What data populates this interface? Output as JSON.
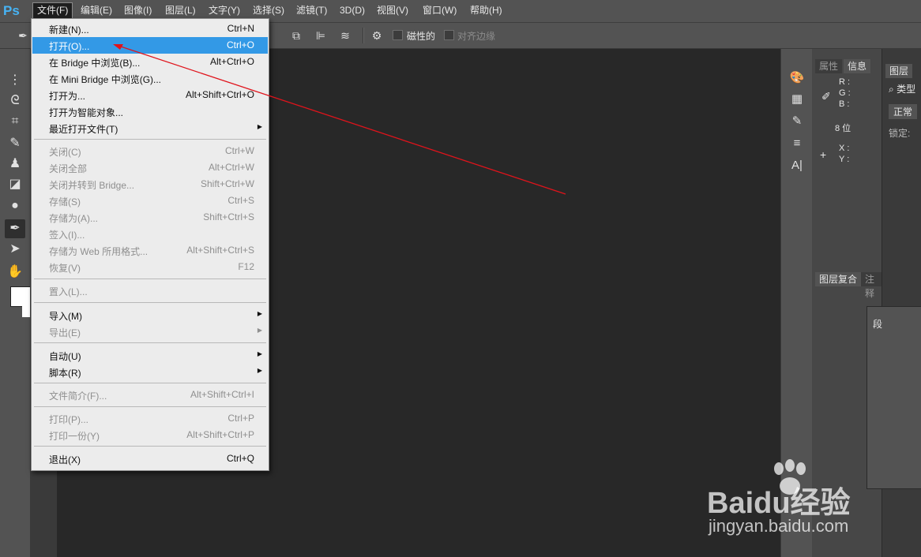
{
  "app": {
    "logo": "Ps"
  },
  "menubar": {
    "items": [
      "文件(F)",
      "编辑(E)",
      "图像(I)",
      "图层(L)",
      "文字(Y)",
      "选择(S)",
      "滤镜(T)",
      "3D(D)",
      "视图(V)",
      "窗口(W)",
      "帮助(H)"
    ]
  },
  "options_bar": {
    "magnetic_label": "磁性的",
    "align_edges_label": "对齐边缘"
  },
  "file_menu": {
    "items": [
      {
        "label": "新建(N)...",
        "shortcut": "Ctrl+N"
      },
      {
        "label": "打开(O)...",
        "shortcut": "Ctrl+O"
      },
      {
        "label": "在 Bridge 中浏览(B)...",
        "shortcut": "Alt+Ctrl+O"
      },
      {
        "label": "在 Mini Bridge 中浏览(G)...",
        "shortcut": ""
      },
      {
        "label": "打开为...",
        "shortcut": "Alt+Shift+Ctrl+O"
      },
      {
        "label": "打开为智能对象...",
        "shortcut": ""
      },
      {
        "label": "最近打开文件(T)",
        "shortcut": ""
      },
      {
        "label": "关闭(C)",
        "shortcut": "Ctrl+W"
      },
      {
        "label": "关闭全部",
        "shortcut": "Alt+Ctrl+W"
      },
      {
        "label": "关闭并转到 Bridge...",
        "shortcut": "Shift+Ctrl+W"
      },
      {
        "label": "存储(S)",
        "shortcut": "Ctrl+S"
      },
      {
        "label": "存储为(A)...",
        "shortcut": "Shift+Ctrl+S"
      },
      {
        "label": "签入(I)...",
        "shortcut": ""
      },
      {
        "label": "存储为 Web 所用格式...",
        "shortcut": "Alt+Shift+Ctrl+S"
      },
      {
        "label": "恢复(V)",
        "shortcut": "F12"
      },
      {
        "label": "置入(L)...",
        "shortcut": ""
      },
      {
        "label": "导入(M)",
        "shortcut": ""
      },
      {
        "label": "导出(E)",
        "shortcut": ""
      },
      {
        "label": "自动(U)",
        "shortcut": ""
      },
      {
        "label": "脚本(R)",
        "shortcut": ""
      },
      {
        "label": "文件简介(F)...",
        "shortcut": "Alt+Shift+Ctrl+I"
      },
      {
        "label": "打印(P)...",
        "shortcut": "Ctrl+P"
      },
      {
        "label": "打印一份(Y)",
        "shortcut": "Alt+Shift+Ctrl+P"
      },
      {
        "label": "退出(X)",
        "shortcut": "Ctrl+Q"
      }
    ]
  },
  "info_panel": {
    "tabs": [
      "属性",
      "信息"
    ],
    "r": "R :",
    "g": "G :",
    "b": "B :",
    "bits": "8 位",
    "x": "X :",
    "y": "Y :"
  },
  "lower_panel": {
    "tabs": [
      "图层复合",
      "注释"
    ]
  },
  "layers_panel": {
    "tab": "图层",
    "search": "类型",
    "blend_mode": "正常",
    "lock_label": "锁定:"
  },
  "paragraph_panel": {
    "label": "段"
  },
  "watermark": {
    "brand": "Baidu经验",
    "url": "jingyan.baidu.com"
  },
  "colors": {
    "highlight": "#3399e6",
    "annotation_arrow": "#e0131b"
  }
}
